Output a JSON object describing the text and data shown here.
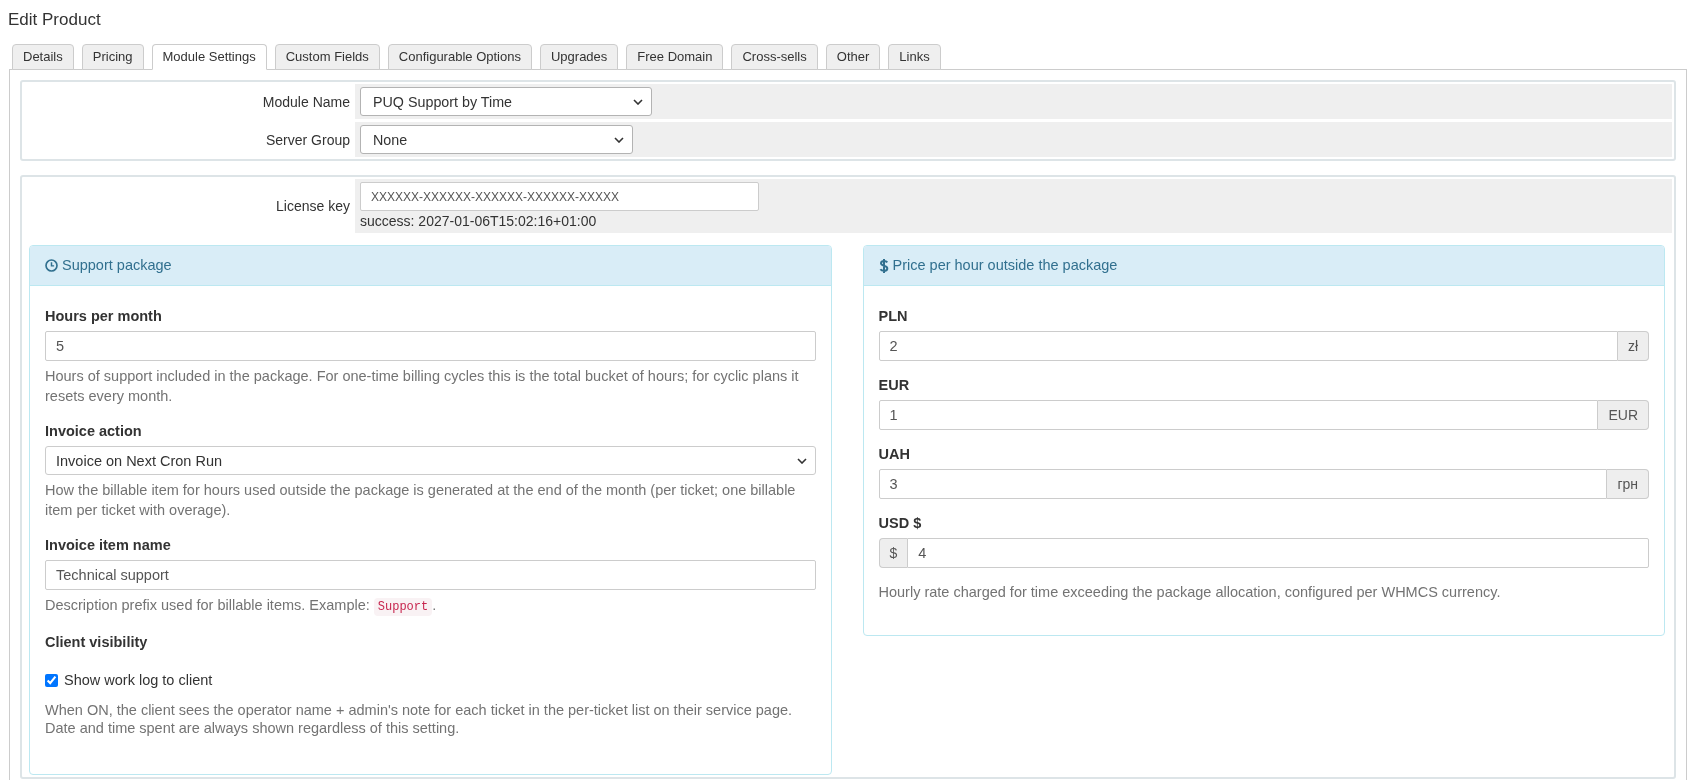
{
  "page": {
    "title": "Edit Product"
  },
  "tabs": [
    {
      "label": "Details",
      "selected": false
    },
    {
      "label": "Pricing",
      "selected": false
    },
    {
      "label": "Module Settings",
      "selected": true
    },
    {
      "label": "Custom Fields",
      "selected": false
    },
    {
      "label": "Configurable Options",
      "selected": false
    },
    {
      "label": "Upgrades",
      "selected": false
    },
    {
      "label": "Free Domain",
      "selected": false
    },
    {
      "label": "Cross-sells",
      "selected": false
    },
    {
      "label": "Other",
      "selected": false
    },
    {
      "label": "Links",
      "selected": false
    }
  ],
  "module": {
    "rows": [
      {
        "label": "Module Name",
        "value": "PUQ Support by Time"
      },
      {
        "label": "Server Group",
        "value": "None"
      }
    ]
  },
  "license": {
    "label": "License key",
    "value": "XXXXXX-XXXXXX-XXXXXX-XXXXXX-XXXXX",
    "status": "success: 2027-01-06T15:02:16+01:00"
  },
  "panels": [
    {
      "title": "Support package",
      "fields": [
        {
          "kind": "text",
          "label": "Hours per month",
          "value": "5",
          "help": "Hours of support included in the package. For one-time billing cycles this is the total bucket of hours; for cyclic plans it resets every month."
        },
        {
          "kind": "select",
          "label": "Invoice action",
          "value": "Invoice on Next Cron Run",
          "help": "How the billable item for hours used outside the package is generated at the end of the month (per ticket; one billable item per ticket with overage)."
        },
        {
          "kind": "text",
          "label": "Invoice item name",
          "value": "Technical support",
          "help": "Description prefix used for billable items. Example:",
          "help_code": "Support",
          "help_end": "."
        },
        {
          "kind": "checkbox",
          "label": "Client visibility",
          "option": "Show work log to client",
          "checked": true,
          "help": "When ON, the client sees the operator name + admin's note for each ticket in the per-ticket list on their service page. Date and time spent are always shown regardless of this setting."
        }
      ]
    },
    {
      "title": "Price per hour outside the package",
      "fields": [
        {
          "kind": "suffix",
          "label": "PLN",
          "value": "2",
          "addon": "zł"
        },
        {
          "kind": "suffix",
          "label": "EUR",
          "value": "1",
          "addon": "EUR"
        },
        {
          "kind": "suffix",
          "label": "UAH",
          "value": "3",
          "addon": "грн"
        },
        {
          "kind": "prefix",
          "label": "USD $",
          "value": "4",
          "addon": "$"
        }
      ],
      "note": "Hourly rate charged for time exceeding the package allocation, configured per WHMCS currency."
    }
  ]
}
